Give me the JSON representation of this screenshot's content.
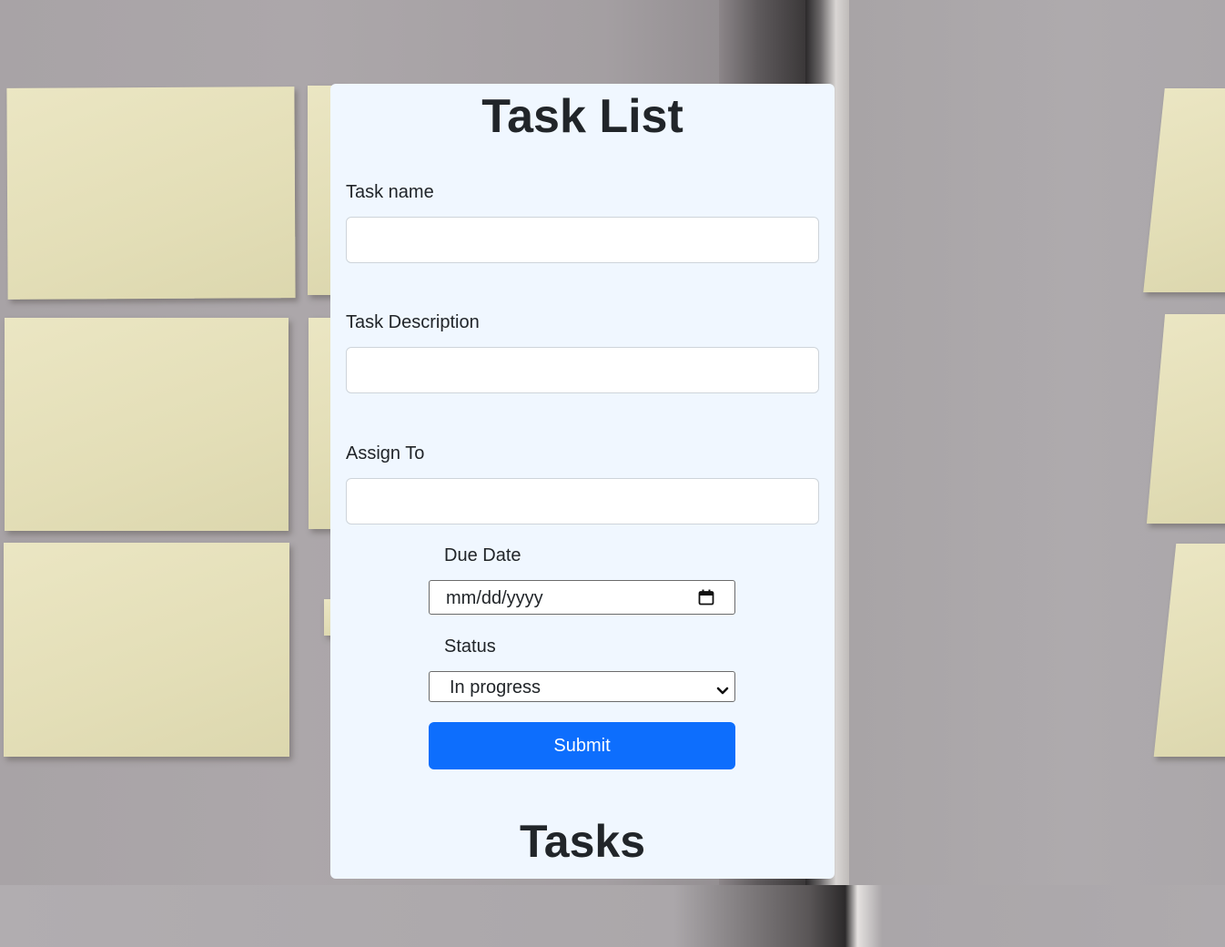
{
  "app": {
    "title": "Task List"
  },
  "form": {
    "task_name": {
      "label": "Task name",
      "value": "",
      "placeholder": ""
    },
    "task_description": {
      "label": "Task Description",
      "value": "",
      "placeholder": ""
    },
    "assign_to": {
      "label": "Assign To",
      "value": "",
      "placeholder": ""
    },
    "due_date": {
      "label": "Due Date",
      "display": "mm/dd/yyyy",
      "icon": "calendar-icon"
    },
    "status": {
      "label": "Status",
      "selected": "In progress",
      "icon": "chevron-down-icon"
    },
    "submit_label": "Submit"
  },
  "tasks_section": {
    "heading": "Tasks"
  },
  "colors": {
    "card_background": "#f0f7ff",
    "primary_button": "#0d6efd",
    "text": "#212529",
    "sticky_note": "#e6e1bb"
  }
}
